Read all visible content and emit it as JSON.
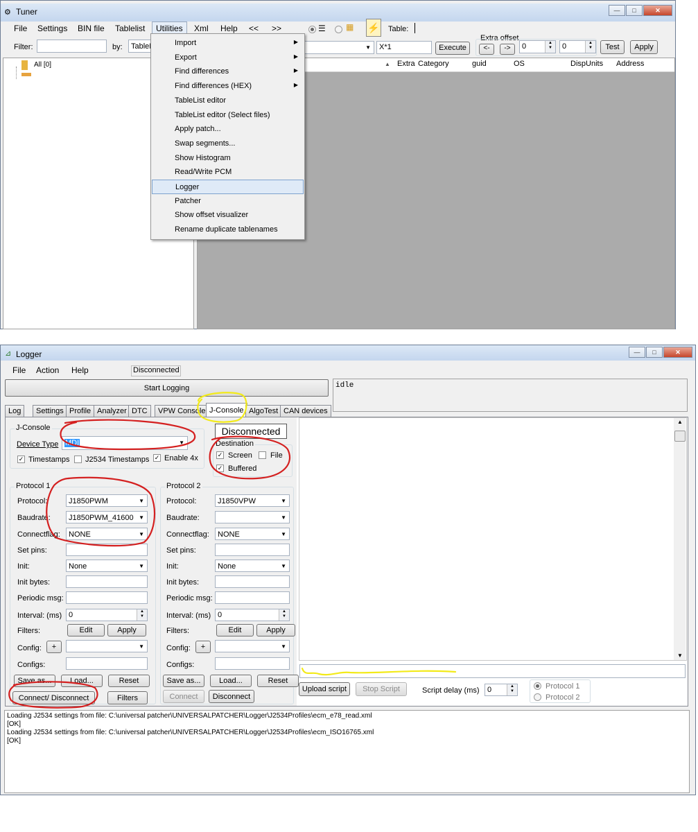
{
  "tuner": {
    "title": "Tuner",
    "menu": [
      "File",
      "Settings",
      "BIN file",
      "Tablelist",
      "Utilities",
      "Xml",
      "Help",
      "<<",
      ">>"
    ],
    "table_label": "Table:",
    "filter_label": "Filter:",
    "by_label": "by:",
    "by_value": "TableN",
    "formula_value": "X*1",
    "execute_label": "Execute",
    "extra_offset_label": "Extra offset",
    "prev_label": "<-",
    "next_label": "->",
    "offset1_value": "0",
    "offset2_value": "0",
    "test_label": "Test",
    "apply_label": "Apply",
    "tree_root": "All [0]",
    "columns": [
      "Extra",
      "Category",
      "guid",
      "OS",
      "DispUnits",
      "Address"
    ],
    "utilities_menu": [
      {
        "label": "Import",
        "submenu": true
      },
      {
        "label": "Export",
        "submenu": true
      },
      {
        "label": "Find differences",
        "submenu": true
      },
      {
        "label": "Find differences (HEX)",
        "submenu": true
      },
      {
        "label": "TableList editor",
        "submenu": false
      },
      {
        "label": "TableList editor (Select files)",
        "submenu": false
      },
      {
        "label": "Apply patch...",
        "submenu": false
      },
      {
        "label": "Swap segments...",
        "submenu": false
      },
      {
        "label": "Show Histogram",
        "submenu": false
      },
      {
        "label": "Read/Write PCM",
        "submenu": false
      },
      {
        "label": "Logger",
        "submenu": false,
        "highlighted": true
      },
      {
        "label": "Patcher",
        "submenu": false
      },
      {
        "label": "Show offset visualizer",
        "submenu": false
      },
      {
        "label": "Rename duplicate tablenames",
        "submenu": false
      }
    ]
  },
  "logger": {
    "title": "Logger",
    "menu": [
      "File",
      "Action",
      "Help"
    ],
    "status": "Disconnected",
    "start_logging": "Start Logging",
    "idle_text": "idle",
    "tabs": [
      "Log",
      "Settings",
      "Profile",
      "Analyzer",
      "DTC",
      "VPW Console",
      "J-Console",
      "AlgoTest",
      "CAN devices"
    ],
    "selected_tab": "J-Console",
    "jconsole": {
      "group_title": "J-Console",
      "device_type_label": "Device Type",
      "device_type_value": "MDI",
      "timestamps_label": "Timestamps",
      "timestamps_checked": true,
      "j2534_timestamps_label": "J2534 Timestamps",
      "j2534_timestamps_checked": false,
      "enable4x_label": "Enable 4x",
      "enable4x_checked": true,
      "connection_status": "Disconnected",
      "destination_title": "Destination",
      "screen_label": "Screen",
      "screen_checked": true,
      "file_label": "File",
      "file_checked": false,
      "buffered_label": "Buffered",
      "buffered_checked": true
    },
    "protocol1": {
      "title": "Protocol 1",
      "protocol_label": "Protocol:",
      "protocol_value": "J1850PWM",
      "baudrate_label": "Baudrate:",
      "baudrate_value": "J1850PWM_41600",
      "connectflag_label": "Connectflag:",
      "connectflag_value": "NONE",
      "setpins_label": "Set pins:",
      "init_label": "Init:",
      "init_value": "None",
      "initbytes_label": "Init bytes:",
      "periodic_label": "Periodic msg:",
      "interval_label": "Interval: (ms)",
      "interval_value": "0",
      "filters_label": "Filters:",
      "edit_label": "Edit",
      "apply_label": "Apply",
      "config_label": "Config:",
      "plus_label": "+",
      "configs_label": "Configs:",
      "saveas_label": "Save as...",
      "load_label": "Load...",
      "reset_label": "Reset",
      "connect_disconnect_label": "Connect/ Disconnect",
      "filters_btn_label": "Filters"
    },
    "protocol2": {
      "title": "Protocol 2",
      "protocol_label": "Protocol:",
      "protocol_value": "J1850VPW",
      "baudrate_label": "Baudrate:",
      "baudrate_value": "",
      "connectflag_label": "Connectflag:",
      "connectflag_value": "NONE",
      "setpins_label": "Set pins:",
      "init_label": "Init:",
      "init_value": "None",
      "initbytes_label": "Init bytes:",
      "periodic_label": "Periodic msg:",
      "interval_label": "Interval: (ms)",
      "interval_value": "0",
      "filters_label": "Filters:",
      "edit_label": "Edit",
      "apply_label": "Apply",
      "config_label": "Config:",
      "plus_label": "+",
      "configs_label": "Configs:",
      "saveas_label": "Save as...",
      "load_label": "Load...",
      "reset_label": "Reset",
      "connect_label": "Connect",
      "disconnect_label": "Disconnect"
    },
    "script": {
      "upload_label": "Upload script",
      "stop_label": "Stop Script",
      "delay_label": "Script delay (ms)",
      "delay_value": "0",
      "protocol1_label": "Protocol 1",
      "protocol2_label": "Protocol 2"
    },
    "log_lines": [
      "Loading J2534 settings from file: C:\\universal patcher\\UNIVERSALPATCHER\\Logger\\J2534Profiles\\ecm_e78_read.xml",
      "[OK]",
      "Loading J2534 settings from file: C:\\universal patcher\\UNIVERSALPATCHER\\Logger\\J2534Profiles\\ecm_ISO16765.xml",
      "[OK]"
    ]
  },
  "colors": {
    "annotation_red": "#d42020",
    "annotation_yellow": "#f2ea1a",
    "selection_blue": "#3399ff",
    "grid_gray": "#ababab"
  }
}
